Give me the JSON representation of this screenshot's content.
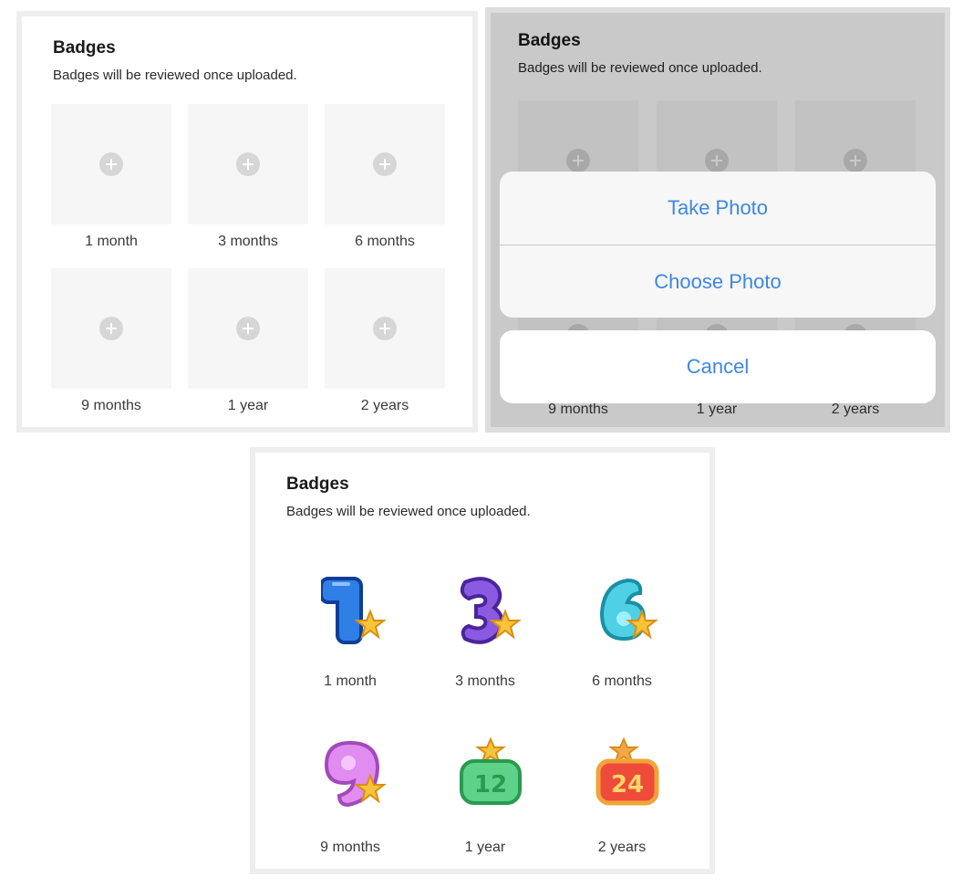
{
  "section": {
    "title": "Badges",
    "subtitle": "Badges will be reviewed once uploaded."
  },
  "badges": [
    {
      "label": "1 month",
      "icon": "plus-circle-icon",
      "badge_icon": "badge-1-blue-icon",
      "color": "#2f7fe6"
    },
    {
      "label": "3 months",
      "icon": "plus-circle-icon",
      "badge_icon": "badge-3-purple-icon",
      "color": "#8a5be0"
    },
    {
      "label": "6 months",
      "icon": "plus-circle-icon",
      "badge_icon": "badge-6-cyan-icon",
      "color": "#4fd0e4"
    },
    {
      "label": "9 months",
      "icon": "plus-circle-icon",
      "badge_icon": "badge-9-pink-icon",
      "color": "#e08cf0"
    },
    {
      "label": "1 year",
      "icon": "plus-circle-icon",
      "badge_icon": "badge-12-green-icon",
      "color": "#5fd28a"
    },
    {
      "label": "2 years",
      "icon": "plus-circle-icon",
      "badge_icon": "badge-24-red-icon",
      "color": "#ef4b3a"
    }
  ],
  "action_sheet": {
    "take_photo": "Take Photo",
    "choose_photo": "Choose Photo",
    "cancel": "Cancel",
    "accent": "#3d87e4"
  },
  "colors": {
    "tile_bg": "#f6f6f6",
    "star": "#f6c33a"
  }
}
